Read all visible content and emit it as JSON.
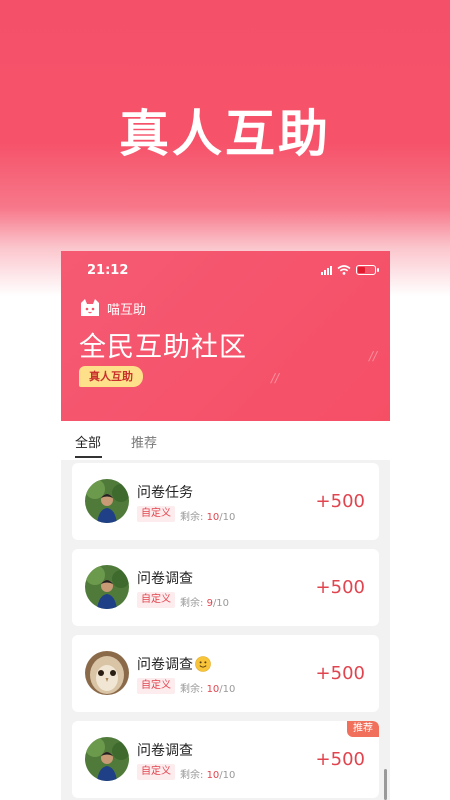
{
  "promo": {
    "title": "真人互助"
  },
  "status": {
    "time": "21:12",
    "battery_color": "#e01b2f"
  },
  "header": {
    "app_icon": "cat-icon",
    "app_name": "喵互助",
    "title": "全民互助社区",
    "badge": "真人互助",
    "accent": "#f5546a"
  },
  "tabs": [
    {
      "label": "全部",
      "active": true
    },
    {
      "label": "推荐",
      "active": false
    }
  ],
  "tasks": [
    {
      "title": "问卷任务",
      "tag": "自定义",
      "remain_label": "剩余: ",
      "remain_done": "10",
      "remain_total": "/10",
      "reward": "+500",
      "avatar": "man-avatar",
      "emoji": "",
      "badge": ""
    },
    {
      "title": "问卷调查",
      "tag": "自定义",
      "remain_label": "剩余: ",
      "remain_done": "9",
      "remain_total": "/10",
      "reward": "+500",
      "avatar": "man-avatar",
      "emoji": "",
      "badge": ""
    },
    {
      "title": "问卷调查",
      "tag": "自定义",
      "remain_label": "剩余: ",
      "remain_done": "10",
      "remain_total": "/10",
      "reward": "+500",
      "avatar": "owl-avatar",
      "emoji": "smile-emoji",
      "badge": ""
    },
    {
      "title": "问卷调查",
      "tag": "自定义",
      "remain_label": "剩余: ",
      "remain_done": "10",
      "remain_total": "/10",
      "reward": "+500",
      "avatar": "man-avatar",
      "emoji": "",
      "badge": "推荐"
    }
  ]
}
